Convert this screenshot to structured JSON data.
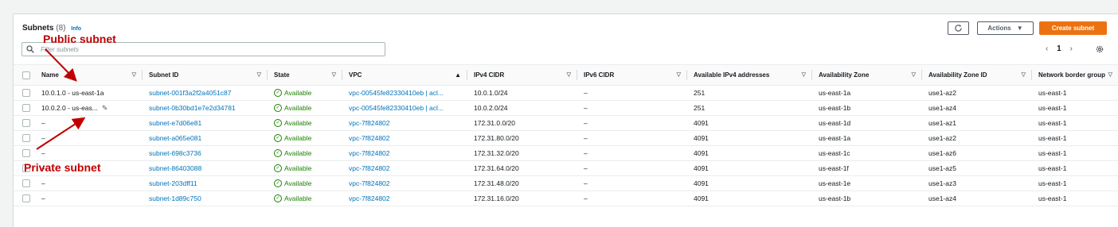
{
  "header": {
    "title": "Subnets",
    "count": "(8)",
    "info": "Info"
  },
  "search": {
    "placeholder": "Filter subnets"
  },
  "toolbar": {
    "actions_label": "Actions",
    "create_label": "Create subnet"
  },
  "pager": {
    "prev": "‹",
    "page": "1",
    "next": "›"
  },
  "icons": {
    "refresh": "refresh-icon",
    "search": "search-icon",
    "settings": "gear-icon",
    "status": "check-circle-icon",
    "edit": "edit-icon"
  },
  "colors": {
    "accent": "#ec7211",
    "link": "#0073bb",
    "status_ok": "#1d8102",
    "annotation": "#c00000"
  },
  "table": {
    "columns": [
      "Name",
      "Subnet ID",
      "State",
      "VPC",
      "IPv4 CIDR",
      "IPv6 CIDR",
      "Available IPv4 addresses",
      "Availability Zone",
      "Availability Zone ID",
      "Network border group"
    ],
    "rows": [
      {
        "name": "10.0.1.0 - us-east-1a",
        "subnet_id": "subnet-001f3a2f2a4051c87",
        "state": "Available",
        "vpc": "vpc-00545fe82330410eb | acl...",
        "ipv4": "10.0.1.0/24",
        "ipv6": "–",
        "avail": "251",
        "az": "us-east-1a",
        "azid": "use1-az2",
        "nbg": "us-east-1"
      },
      {
        "name": "10.0.2.0 - us-eas...",
        "subnet_id": "subnet-0b30bd1e7e2d34781",
        "state": "Available",
        "vpc": "vpc-00545fe82330410eb | acl...",
        "ipv4": "10.0.2.0/24",
        "ipv6": "–",
        "avail": "251",
        "az": "us-east-1b",
        "azid": "use1-az4",
        "nbg": "us-east-1"
      },
      {
        "name": "–",
        "subnet_id": "subnet-e7d06e81",
        "state": "Available",
        "vpc": "vpc-7f824802",
        "ipv4": "172.31.0.0/20",
        "ipv6": "–",
        "avail": "4091",
        "az": "us-east-1d",
        "azid": "use1-az1",
        "nbg": "us-east-1"
      },
      {
        "name": "–",
        "subnet_id": "subnet-a065e081",
        "state": "Available",
        "vpc": "vpc-7f824802",
        "ipv4": "172.31.80.0/20",
        "ipv6": "–",
        "avail": "4091",
        "az": "us-east-1a",
        "azid": "use1-az2",
        "nbg": "us-east-1"
      },
      {
        "name": "–",
        "subnet_id": "subnet-698c3736",
        "state": "Available",
        "vpc": "vpc-7f824802",
        "ipv4": "172.31.32.0/20",
        "ipv6": "–",
        "avail": "4091",
        "az": "us-east-1c",
        "azid": "use1-az6",
        "nbg": "us-east-1"
      },
      {
        "name": "–",
        "subnet_id": "subnet-86403088",
        "state": "Available",
        "vpc": "vpc-7f824802",
        "ipv4": "172.31.64.0/20",
        "ipv6": "–",
        "avail": "4091",
        "az": "us-east-1f",
        "azid": "use1-az5",
        "nbg": "us-east-1"
      },
      {
        "name": "–",
        "subnet_id": "subnet-203dff11",
        "state": "Available",
        "vpc": "vpc-7f824802",
        "ipv4": "172.31.48.0/20",
        "ipv6": "–",
        "avail": "4091",
        "az": "us-east-1e",
        "azid": "use1-az3",
        "nbg": "us-east-1"
      },
      {
        "name": "–",
        "subnet_id": "subnet-1d89c750",
        "state": "Available",
        "vpc": "vpc-7f824802",
        "ipv4": "172.31.16.0/20",
        "ipv6": "–",
        "avail": "4091",
        "az": "us-east-1b",
        "azid": "use1-az4",
        "nbg": "us-east-1"
      }
    ]
  },
  "annotations": {
    "public": "Public subnet",
    "private": "Private subnet"
  }
}
